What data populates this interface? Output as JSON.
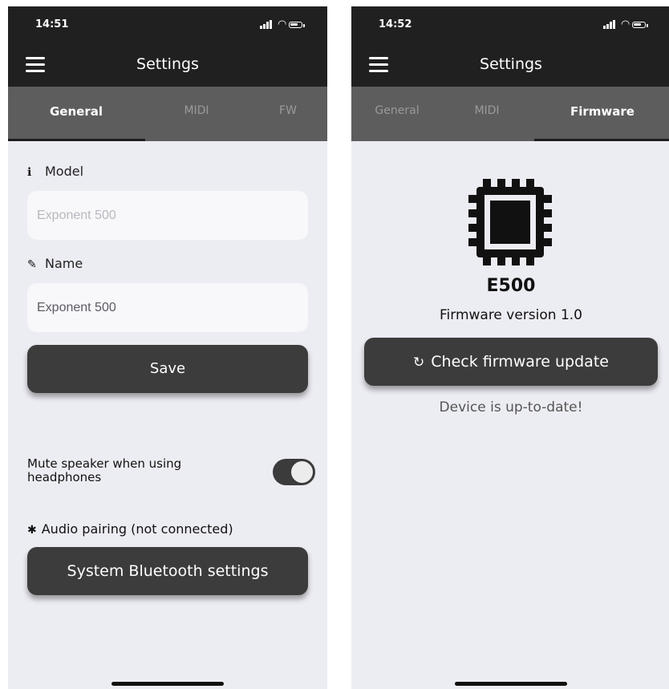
{
  "left": {
    "status": {
      "time": "14:51"
    },
    "header": {
      "title": "Settings"
    },
    "tabs": [
      "General",
      "MIDI",
      "FW"
    ],
    "model": {
      "label": "Model",
      "value": "Exponent 500"
    },
    "name": {
      "label": "Name",
      "value": "Exponent 500"
    },
    "save_label": "Save",
    "mute": {
      "label": "Mute speaker when using headphones",
      "enabled": true
    },
    "pairing": {
      "label": "Audio pairing (not connected)"
    },
    "bluetooth_button": "System Bluetooth settings"
  },
  "right": {
    "status": {
      "time": "14:52"
    },
    "header": {
      "title": "Settings"
    },
    "tabs": [
      "General",
      "MIDI",
      "Firmware"
    ],
    "device_name": "E500",
    "firmware_version": "Firmware version 1.0",
    "check_button": "Check firmware update",
    "update_status": "Device is up-to-date!"
  },
  "icons": {
    "info": "info-circle-icon",
    "pencil": "pencil-icon",
    "bluetooth": "bluetooth-icon",
    "refresh": "refresh-icon",
    "chip": "chip-icon"
  },
  "colors": {
    "header": "#202020",
    "tabbar": "#5d5d5d",
    "background": "#ececf3",
    "button": "#3c3c3c"
  }
}
